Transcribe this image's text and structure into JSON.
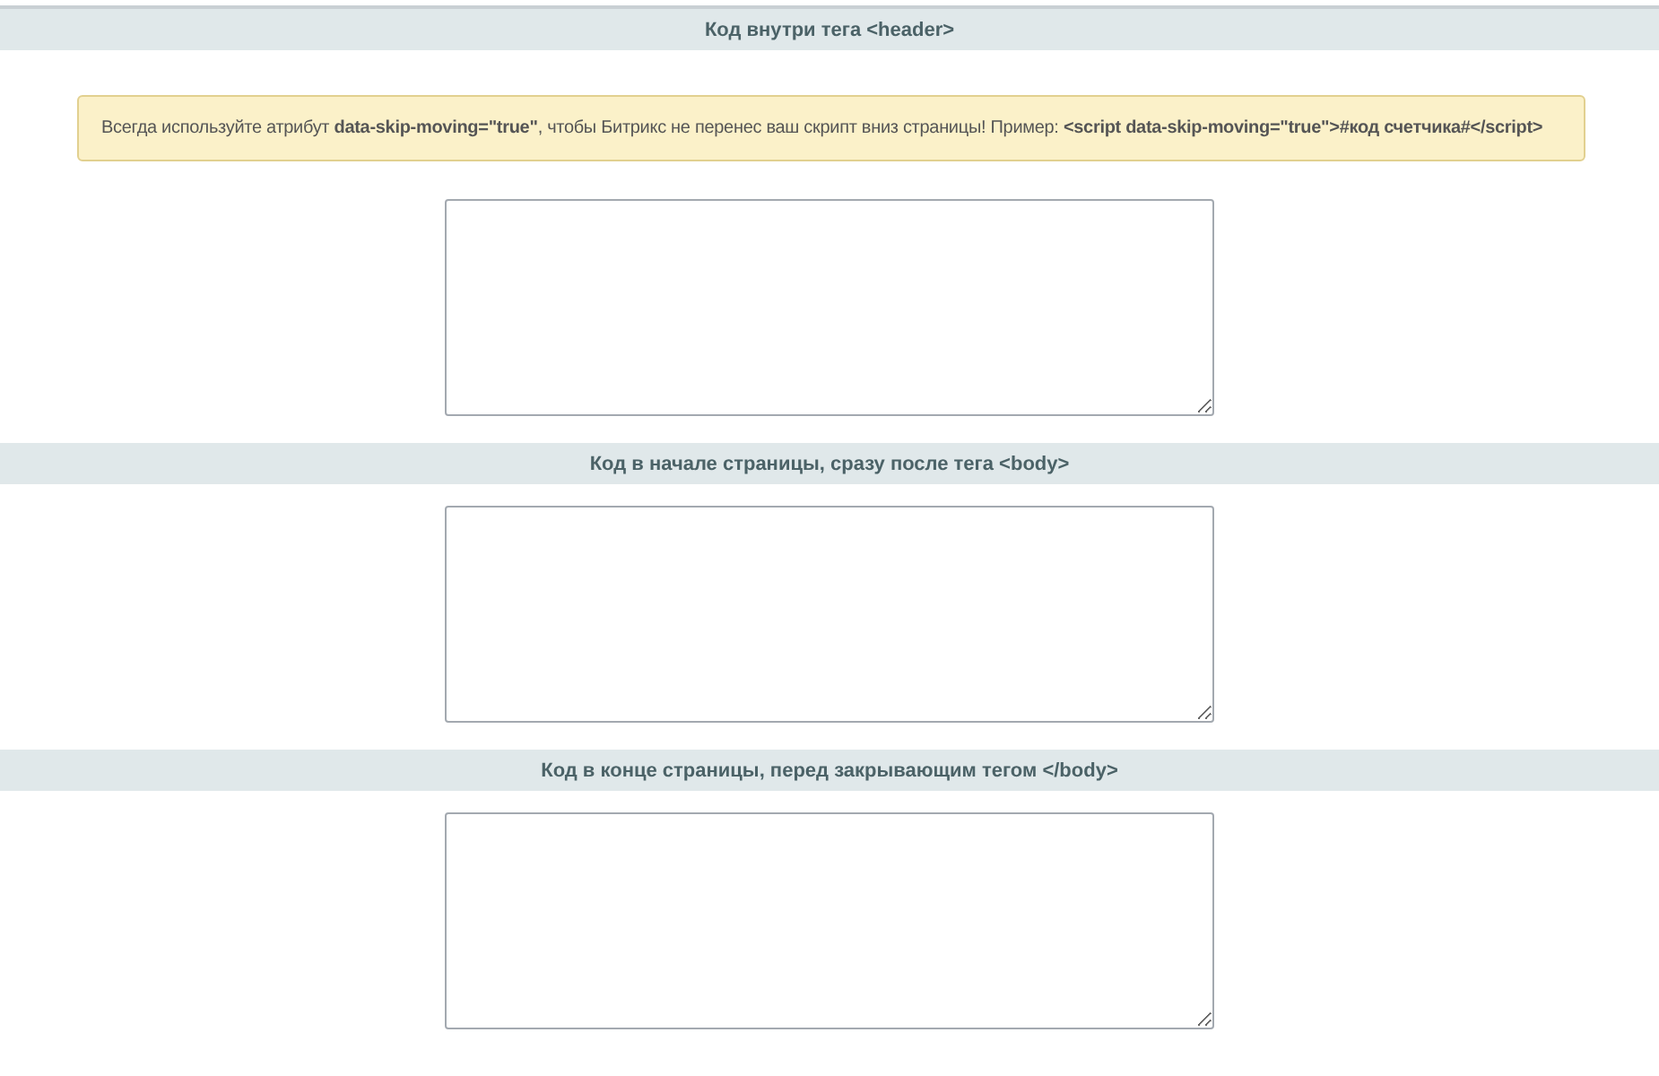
{
  "sections": [
    {
      "title": "Код внутри тега <header>",
      "notice": "Всегда используйте атрибут **data-skip-moving=\"true\"**, чтобы Битрикс не перенес ваш скрипт вниз страницы! Пример: **<script data-skip-moving=\"true\">#код счетчика#</script>**"
    },
    {
      "title": "Код в начале страницы, сразу после тега <body>"
    },
    {
      "title": "Код в конце страницы, перед закрывающим тегом </body>"
    }
  ]
}
